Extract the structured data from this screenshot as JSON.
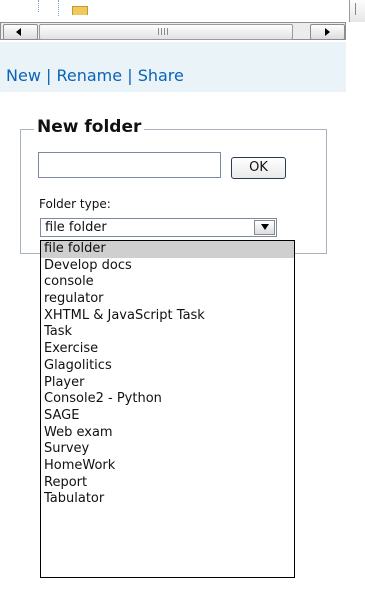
{
  "actions": {
    "new": "New",
    "rename": "Rename",
    "share": "Share",
    "separator": "|"
  },
  "new_folder": {
    "legend": "New folder",
    "name_value": "",
    "ok_label": "OK",
    "folder_type_label": "Folder type:",
    "selected_type": "file folder"
  },
  "folder_types": [
    "file folder",
    "Develop docs",
    "console",
    "regulator",
    "XHTML & JavaScript Task",
    "Task",
    "Exercise",
    "Glagolitics",
    "Player",
    "Console2 - Python",
    "SAGE",
    "Web exam",
    "Survey",
    "HomeWork",
    "Report",
    "Tabulator"
  ],
  "icons": {
    "tree": "folder-icon",
    "left": "arrow-left-icon",
    "right": "arrow-right-icon",
    "dropdown": "chevron-down-icon"
  }
}
